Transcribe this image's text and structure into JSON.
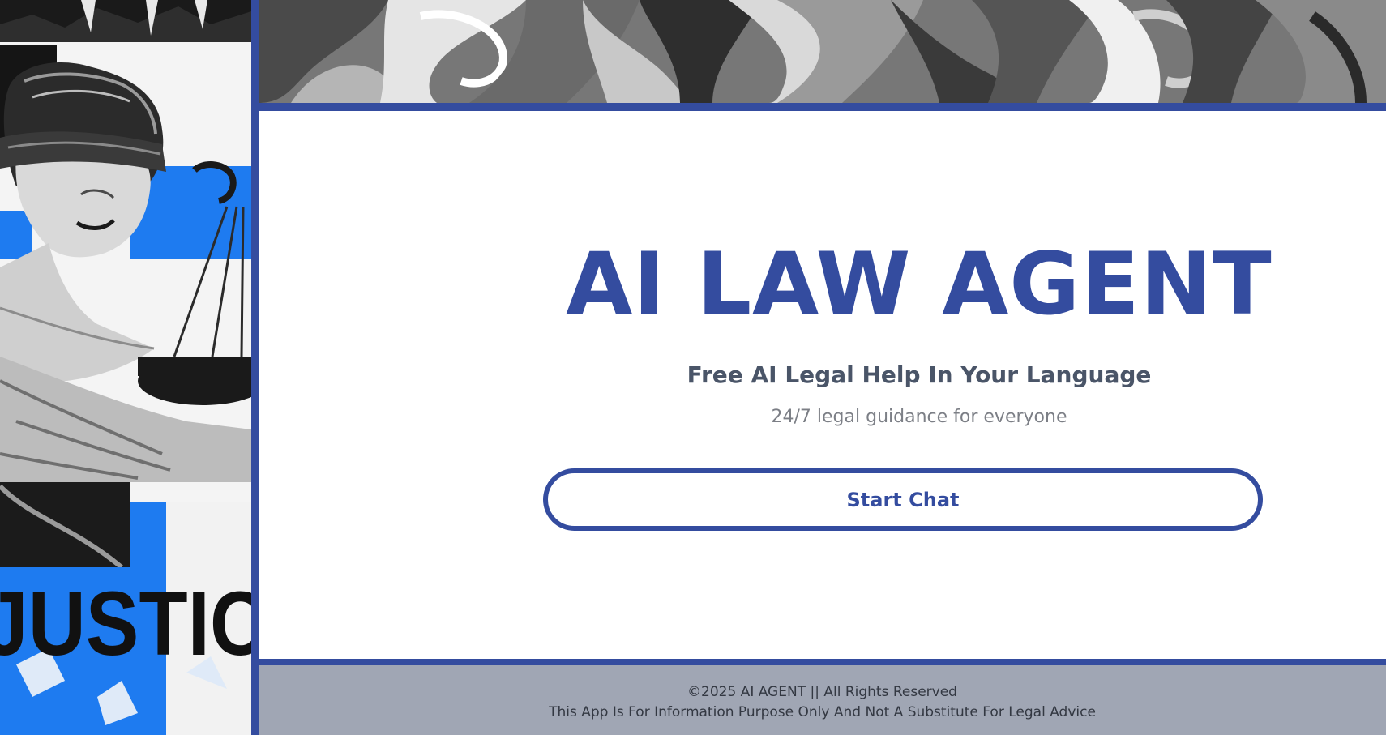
{
  "hero": {
    "title": "AI LAW AGENT",
    "subtitle": "Free AI Legal Help In Your Language",
    "tagline": "24/7 legal guidance for everyone",
    "start_chat_label": "Start Chat"
  },
  "side_art": {
    "poster_word": "JUSTIC"
  },
  "footer": {
    "copyright": "©2025 AI AGENT || All Rights Reserved",
    "disclaimer": "This App Is For Information Purpose Only And Not A Substitute For Legal Advice"
  },
  "colors": {
    "brand_blue": "#344c9f",
    "bright_blue": "#1e7bf0",
    "footer_bg": "#a0a6b4",
    "subtitle_text": "#4a5568",
    "tagline_text": "#7c7f86"
  }
}
